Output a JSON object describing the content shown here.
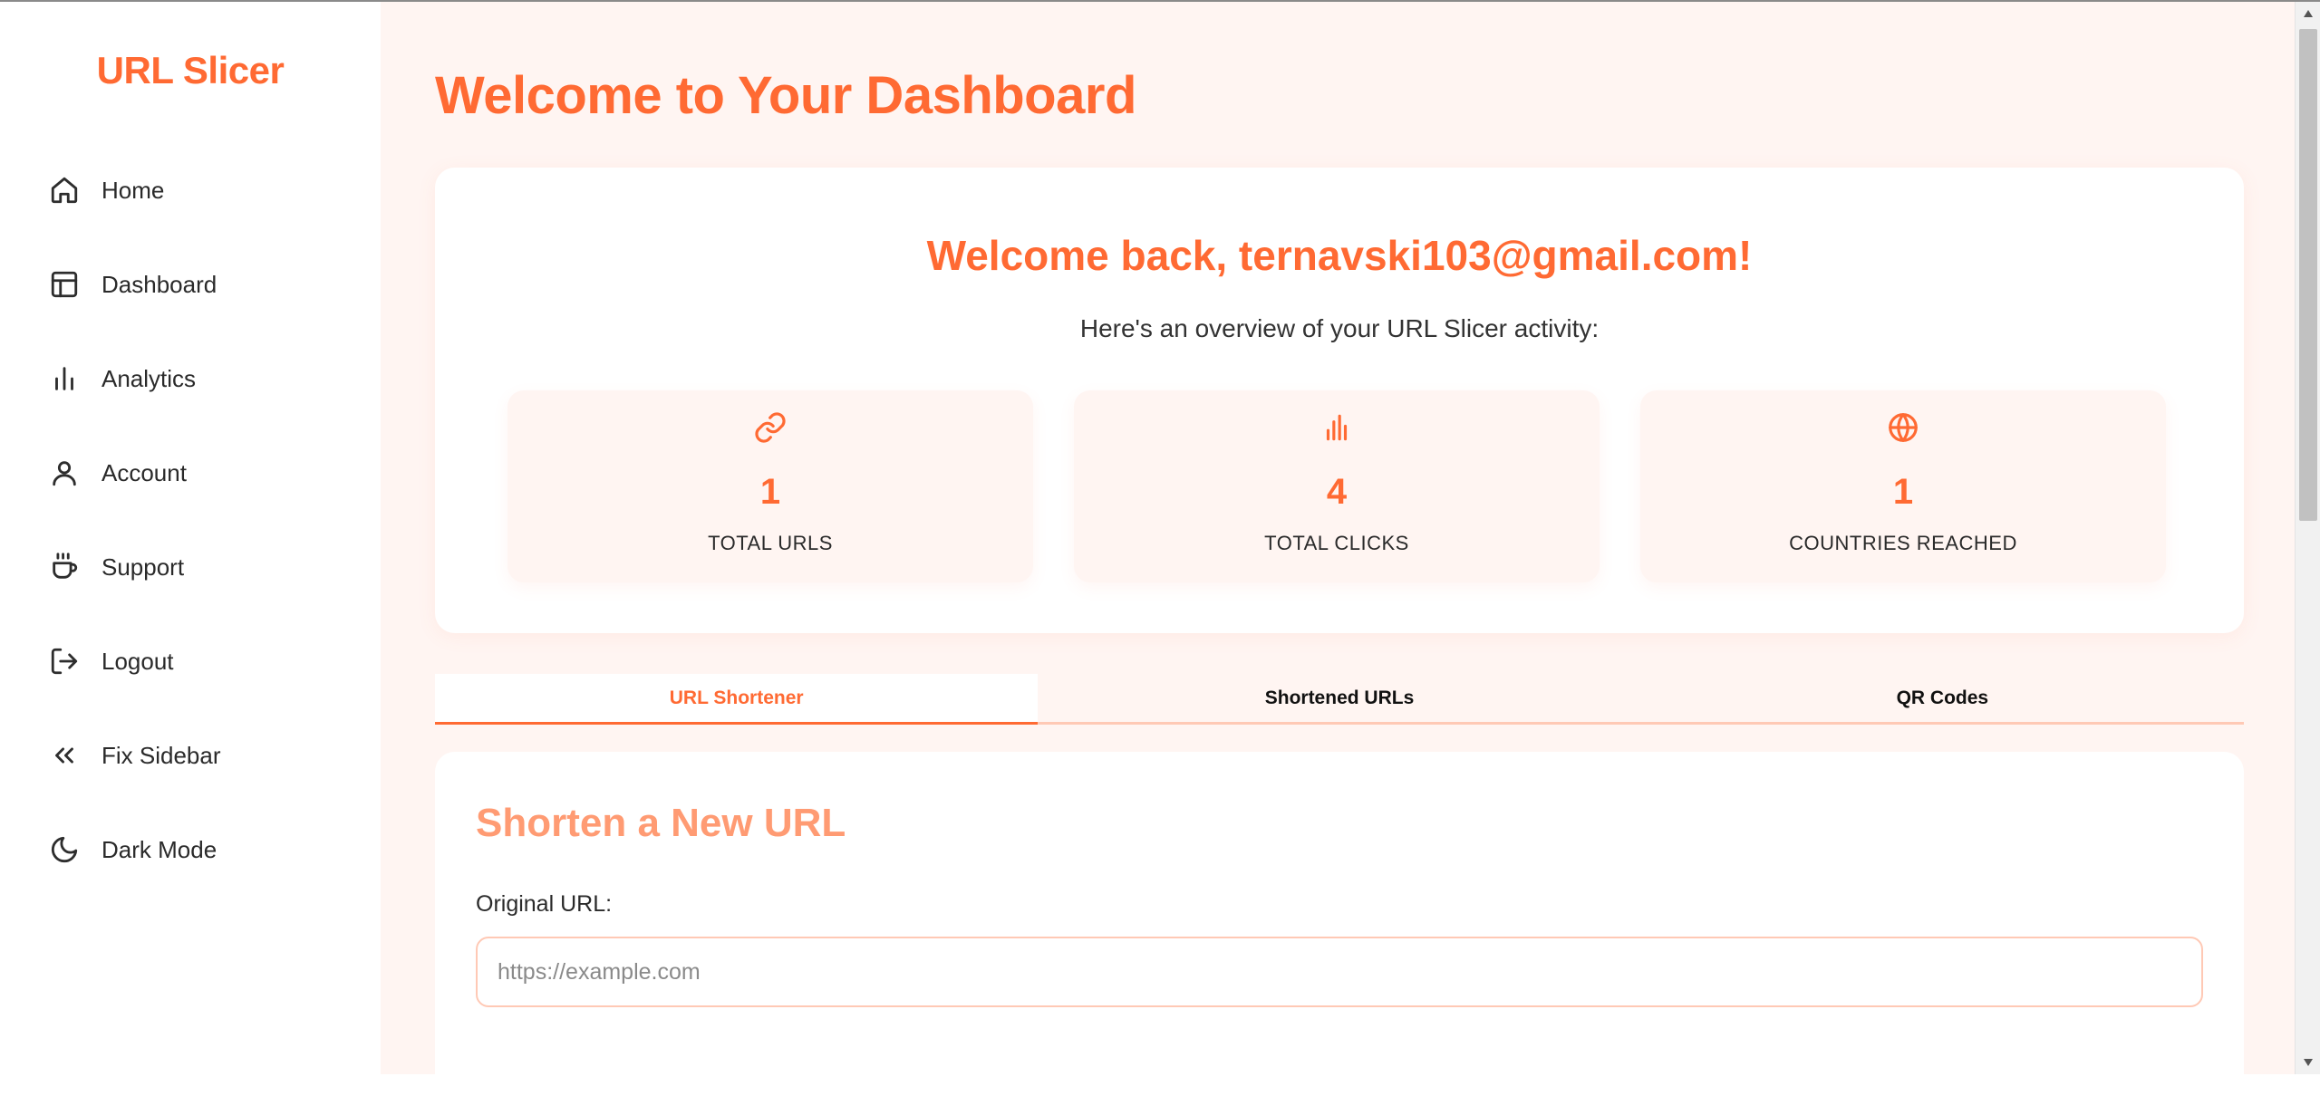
{
  "brand": {
    "name": "URL Slicer"
  },
  "sidebar": {
    "items": [
      {
        "label": "Home",
        "icon": "home-icon"
      },
      {
        "label": "Dashboard",
        "icon": "layout-icon"
      },
      {
        "label": "Analytics",
        "icon": "bar-chart-icon"
      },
      {
        "label": "Account",
        "icon": "user-icon"
      },
      {
        "label": "Support",
        "icon": "coffee-icon"
      },
      {
        "label": "Logout",
        "icon": "logout-icon"
      },
      {
        "label": "Fix Sidebar",
        "icon": "chevrons-left-icon"
      },
      {
        "label": "Dark Mode",
        "icon": "moon-icon"
      }
    ]
  },
  "main": {
    "title": "Welcome to Your Dashboard",
    "welcome": {
      "heading": "Welcome back, ternavski103@gmail.com!",
      "subtitle": "Here's an overview of your URL Slicer activity:"
    },
    "stats": [
      {
        "value": "1",
        "caption": "TOTAL URLS",
        "icon": "link-icon"
      },
      {
        "value": "4",
        "caption": "TOTAL CLICKS",
        "icon": "bar-chart-icon"
      },
      {
        "value": "1",
        "caption": "COUNTRIES REACHED",
        "icon": "globe-icon"
      }
    ],
    "tabs": [
      {
        "label": "URL Shortener",
        "active": true
      },
      {
        "label": "Shortened URLs",
        "active": false
      },
      {
        "label": "QR Codes",
        "active": false
      }
    ],
    "shortener": {
      "title": "Shorten a New URL",
      "field_label": "Original URL:",
      "placeholder": "https://example.com",
      "value": ""
    }
  },
  "colors": {
    "accent": "#ff6a33",
    "accent_light": "#ff9b73",
    "main_background": "#fff5f2",
    "card_background": "#ffffff",
    "input_border": "#ffc9b5"
  }
}
